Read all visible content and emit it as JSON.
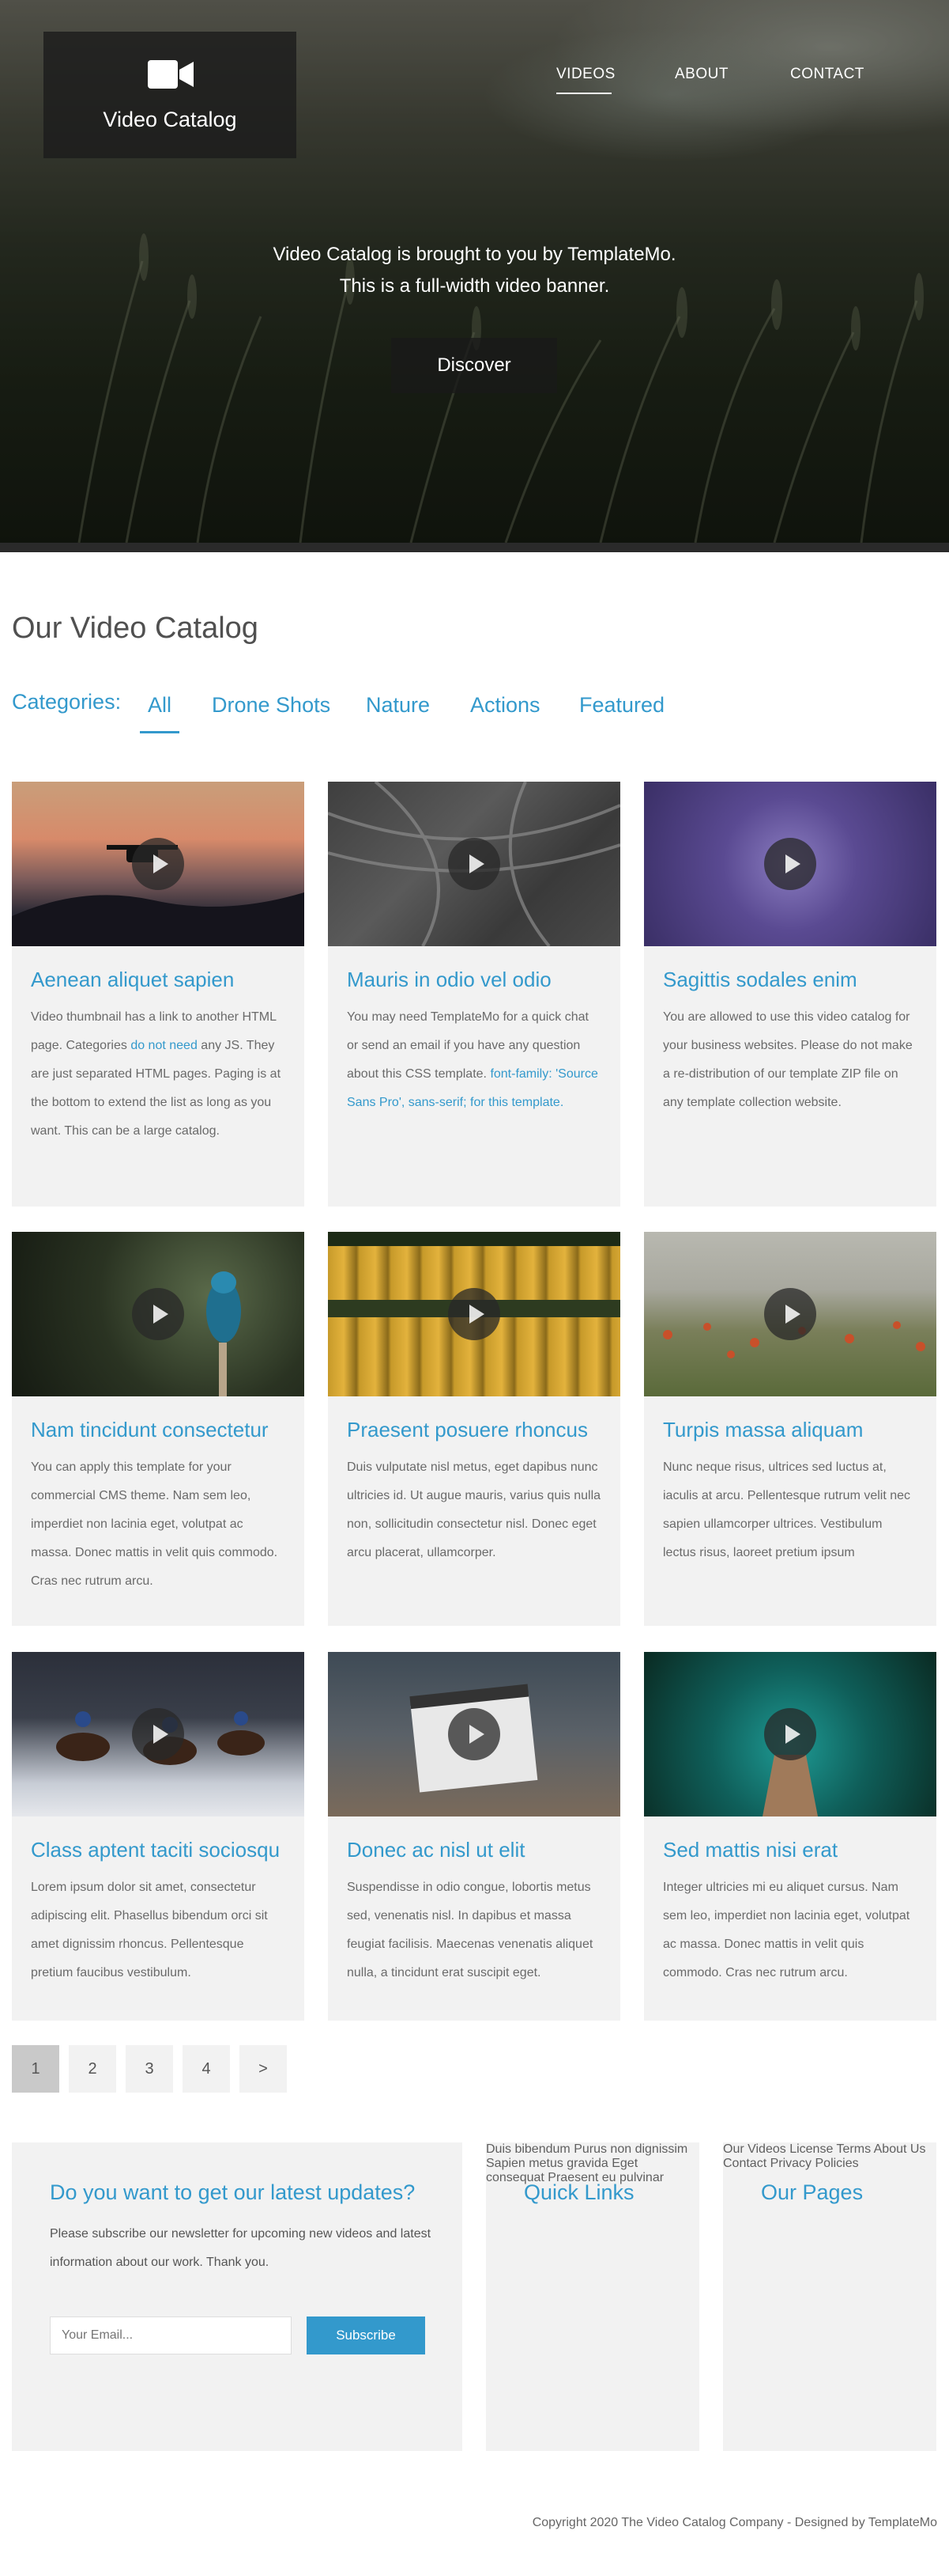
{
  "brand": {
    "name": "Video Catalog",
    "icon": "video-camera-icon"
  },
  "nav": [
    {
      "label": "VIDEOS",
      "active": true
    },
    {
      "label": "ABOUT",
      "active": false
    },
    {
      "label": "CONTACT",
      "active": false
    }
  ],
  "hero": {
    "line1": "Video Catalog is brought to you by TemplateMo.",
    "line2": "This is a full-width video banner.",
    "button": "Discover"
  },
  "catalog": {
    "title": "Our Video Catalog",
    "categories_label": "Categories:",
    "categories": [
      "All",
      "Drone Shots",
      "Nature",
      "Actions",
      "Featured"
    ],
    "active_category": "All"
  },
  "videos": [
    {
      "title": "Aenean aliquet sapien",
      "text_before": "Video thumbnail has a link to another HTML page. Categories ",
      "link": "do not need",
      "text_after": " any JS. They are just separated HTML pages. Paging is at the bottom to extend the list as long as you want. This can be a large catalog."
    },
    {
      "title": "Mauris in odio vel odio",
      "text_before": "You may need TemplateMo for a quick chat or send an email if you have any question about this CSS template. ",
      "link": "font-family: 'Source Sans Pro', sans-serif; for this template.",
      "text_after": ""
    },
    {
      "title": "Sagittis sodales enim",
      "text_before": "You are allowed to use this video catalog for your business websites. Please do not make a re-distribution of our template ZIP file on any template collection website.",
      "link": "",
      "text_after": ""
    },
    {
      "title": "Nam tincidunt consectetur",
      "text_before": "You can apply this template for your commercial CMS theme. Nam sem leo, imperdiet non lacinia eget, volutpat ac massa. Donec mattis in velit quis commodo. Cras nec rutrum arcu.",
      "link": "",
      "text_after": ""
    },
    {
      "title": "Praesent posuere rhoncus",
      "text_before": "Duis vulputate nisl metus, eget dapibus nunc ultricies id. Ut augue mauris, varius quis nulla non, sollicitudin consectetur nisl. Donec eget arcu placerat, ullamcorper.",
      "link": "",
      "text_after": ""
    },
    {
      "title": "Turpis massa aliquam",
      "text_before": "Nunc neque risus, ultrices sed luctus at, iaculis at arcu. Pellentesque rutrum velit nec sapien ullamcorper ultrices. Vestibulum lectus risus, laoreet pretium ipsum",
      "link": "",
      "text_after": ""
    },
    {
      "title": "Class aptent taciti sociosqu",
      "text_before": "Lorem ipsum dolor sit amet, consectetur adipiscing elit. Phasellus bibendum orci sit amet dignissim rhoncus. Pellentesque pretium faucibus vestibulum.",
      "link": "",
      "text_after": ""
    },
    {
      "title": "Donec ac nisl ut elit",
      "text_before": "Suspendisse in odio congue, lobortis metus sed, venenatis nisl. In dapibus et massa feugiat facilisis. Maecenas venenatis aliquet nulla, a tincidunt erat suscipit eget.",
      "link": "",
      "text_after": ""
    },
    {
      "title": "Sed mattis nisi erat",
      "text_before": "Integer ultricies mi eu aliquet cursus. Nam sem leo, imperdiet non lacinia eget, volutpat ac massa. Donec mattis in velit quis commodo. Cras nec rutrum arcu.",
      "link": "",
      "text_after": ""
    }
  ],
  "pagination": [
    "1",
    "2",
    "3",
    "4",
    ">"
  ],
  "pagination_active": "1",
  "newsletter": {
    "title": "Do you want to get our latest updates?",
    "text": "Please subscribe our newsletter for upcoming new videos and latest information about our work. Thank you.",
    "placeholder": "Your Email...",
    "button": "Subscribe"
  },
  "quick_links": {
    "title": "Quick Links",
    "items": [
      "Duis bibendum",
      "Purus non dignissim",
      "Sapien metus gravida",
      "Eget consequat",
      "Praesent eu pulvinar"
    ]
  },
  "our_pages": {
    "title": "Our Pages",
    "items": [
      "Our Videos",
      "License Terms",
      "About Us",
      "Contact",
      "Privacy Policies"
    ]
  },
  "footer": {
    "copyright": "Copyright 2020 The Video Catalog Company - Designed by TemplateMo"
  },
  "colors": {
    "accent": "#3399cc",
    "card_bg": "#f2f2f2"
  }
}
